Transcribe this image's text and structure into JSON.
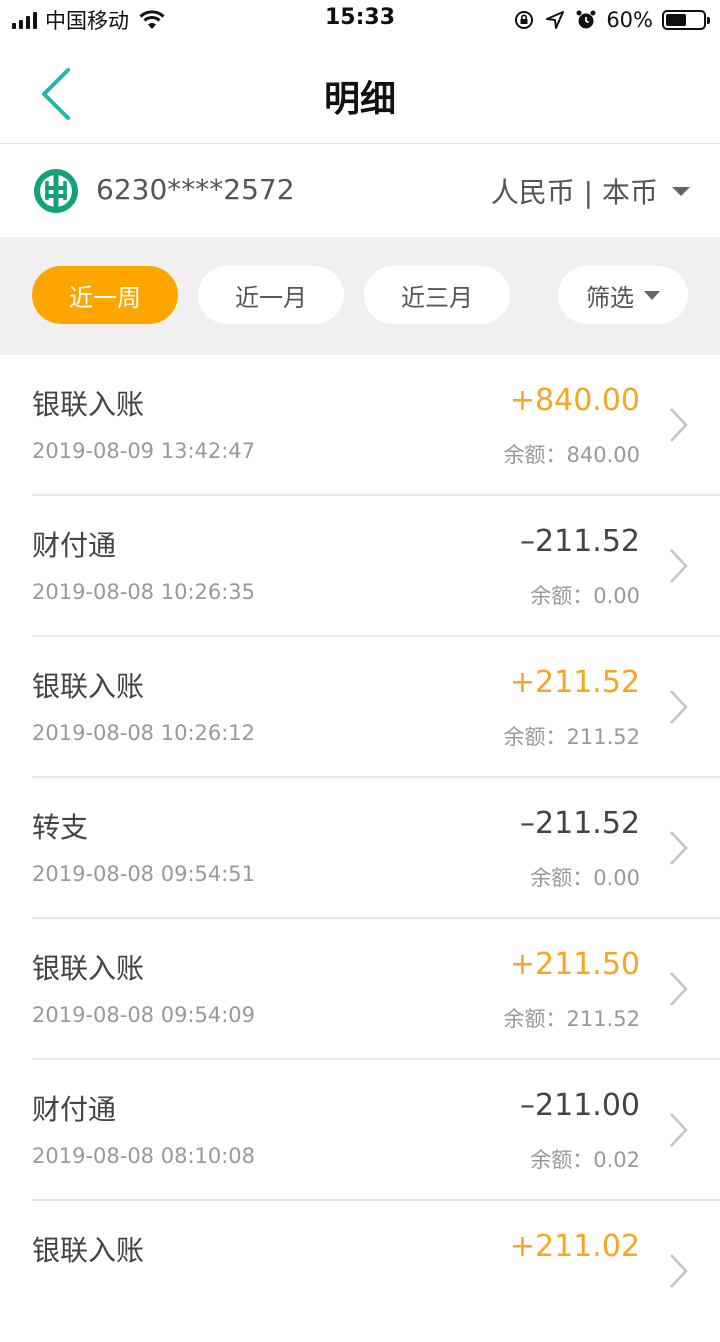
{
  "status_bar": {
    "carrier": "中国移动",
    "time": "15:33",
    "battery_text": "60%",
    "battery_level": 0.6
  },
  "nav": {
    "title": "明细"
  },
  "account": {
    "card_number": "6230****2572",
    "currency_label": "人民币 | 本币",
    "accent_color": "#12a27a"
  },
  "filters": {
    "tabs": [
      "近一周",
      "近一月",
      "近三月"
    ],
    "active_index": 0,
    "filter_label": "筛选",
    "active_color": "#ffa500"
  },
  "transactions": [
    {
      "title": "银联入账",
      "time": "2019-08-09 13:42:47",
      "amount": "+840.00",
      "balance": "余额：840.00",
      "type": "income"
    },
    {
      "title": "财付通",
      "time": "2019-08-08 10:26:35",
      "amount": "–211.52",
      "balance": "余额：0.00",
      "type": "expense"
    },
    {
      "title": "银联入账",
      "time": "2019-08-08 10:26:12",
      "amount": "+211.52",
      "balance": "余额：211.52",
      "type": "income"
    },
    {
      "title": "转支",
      "time": "2019-08-08 09:54:51",
      "amount": "–211.52",
      "balance": "余额：0.00",
      "type": "expense"
    },
    {
      "title": "银联入账",
      "time": "2019-08-08 09:54:09",
      "amount": "+211.50",
      "balance": "余额：211.52",
      "type": "income"
    },
    {
      "title": "财付通",
      "time": "2019-08-08 08:10:08",
      "amount": "–211.00",
      "balance": "余额：0.02",
      "type": "expense"
    },
    {
      "title": "银联入账",
      "time": "",
      "amount": "+211.02",
      "balance": "",
      "type": "income"
    }
  ],
  "colors": {
    "income": "#f5a623",
    "expense": "#444444",
    "back_arrow": "#22b8a6"
  }
}
